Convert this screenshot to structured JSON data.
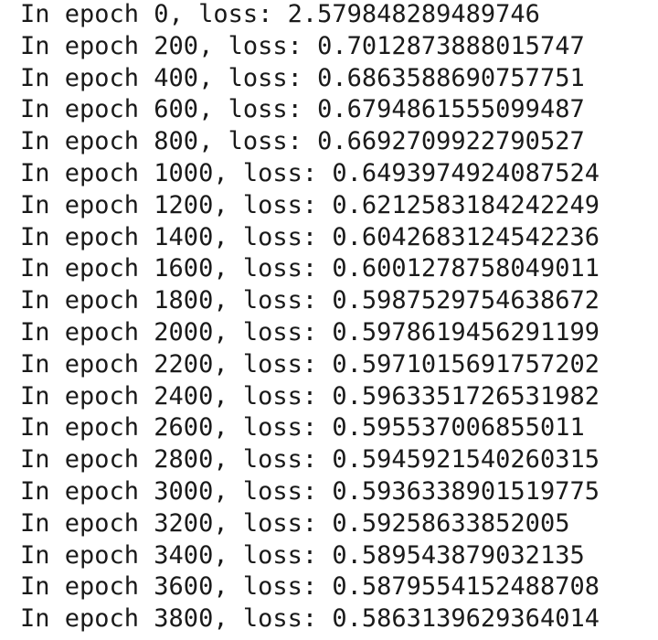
{
  "console": {
    "lines": [
      "In epoch 0, loss: 2.579848289489746",
      "In epoch 200, loss: 0.7012873888015747",
      "In epoch 400, loss: 0.6863588690757751",
      "In epoch 600, loss: 0.6794861555099487",
      "In epoch 800, loss: 0.6692709922790527",
      "In epoch 1000, loss: 0.6493974924087524",
      "In epoch 1200, loss: 0.6212583184242249",
      "In epoch 1400, loss: 0.6042683124542236",
      "In epoch 1600, loss: 0.6001278758049011",
      "In epoch 1800, loss: 0.5987529754638672",
      "In epoch 2000, loss: 0.5978619456291199",
      "In epoch 2200, loss: 0.5971015691757202",
      "In epoch 2400, loss: 0.5963351726531982",
      "In epoch 2600, loss: 0.595537006855011",
      "In epoch 2800, loss: 0.5945921540260315",
      "In epoch 3000, loss: 0.5936338901519775",
      "In epoch 3200, loss: 0.59258633852005",
      "In epoch 3400, loss: 0.589543879032135",
      "In epoch 3600, loss: 0.5879554152488708",
      "In epoch 3800, loss: 0.5863139629364014"
    ]
  }
}
